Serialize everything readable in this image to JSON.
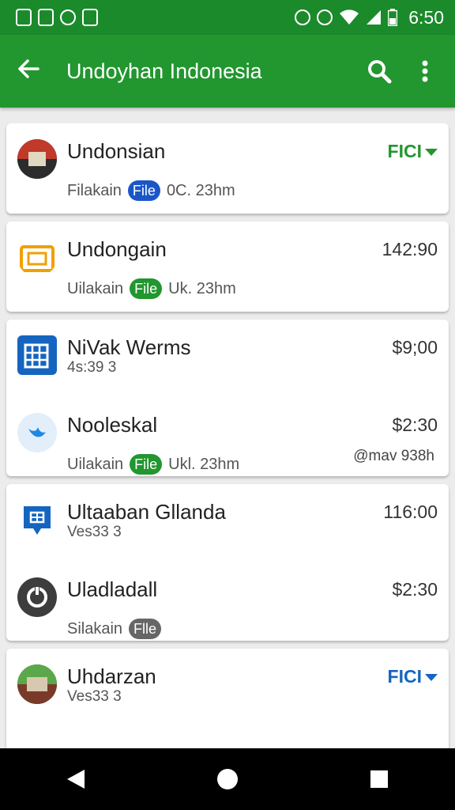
{
  "status_bar": {
    "left_icons": [
      "notification-icon-1",
      "notification-icon-2",
      "notification-icon-3",
      "notification-icon-4"
    ],
    "time": "6:50"
  },
  "app_bar": {
    "title": "Undoyhan Indonesia"
  },
  "colors": {
    "primary": "#22962f",
    "status_bar": "#1b8a2b",
    "blue": "#1565c0",
    "pill_blue": "#1a56c8",
    "pill_green": "#22962f",
    "pill_grey": "#666666"
  },
  "items": [
    {
      "name": "Undonsian",
      "sub_label": "Filakain",
      "pill": "File",
      "sub_value": "0C. 23hm",
      "right": "FICI",
      "avatar": "group-photo-avatar"
    },
    {
      "name": "Undongain",
      "sub_label": "Uilakain",
      "pill": "File",
      "sub_value": "Uk. 23hm",
      "right": "142:90",
      "avatar": "gate-icon"
    },
    {
      "name": "NiVak Werms",
      "sub": "4s:39 3",
      "right": "$9;00",
      "avatar": "building-icon"
    },
    {
      "name": "Nooleskal",
      "sub_label": "Uilakain",
      "pill": "File",
      "sub_value": "Ukl. 23hm",
      "right": "$2:30",
      "bottom_right": "@mav 938h",
      "avatar": "bird-icon"
    },
    {
      "name": "Ultaaban Gllanda",
      "sub": "Ves33 3",
      "right": "116:00",
      "avatar": "location-pin-icon"
    },
    {
      "name": "Uladladall",
      "sub_label": "Silakain",
      "pill": "Flle",
      "right": "$2:30",
      "avatar": "power-icon"
    },
    {
      "name": "Uhdarzan",
      "sub": "Ves33 3",
      "right": "FICI",
      "avatar": "group-photo-avatar"
    }
  ]
}
